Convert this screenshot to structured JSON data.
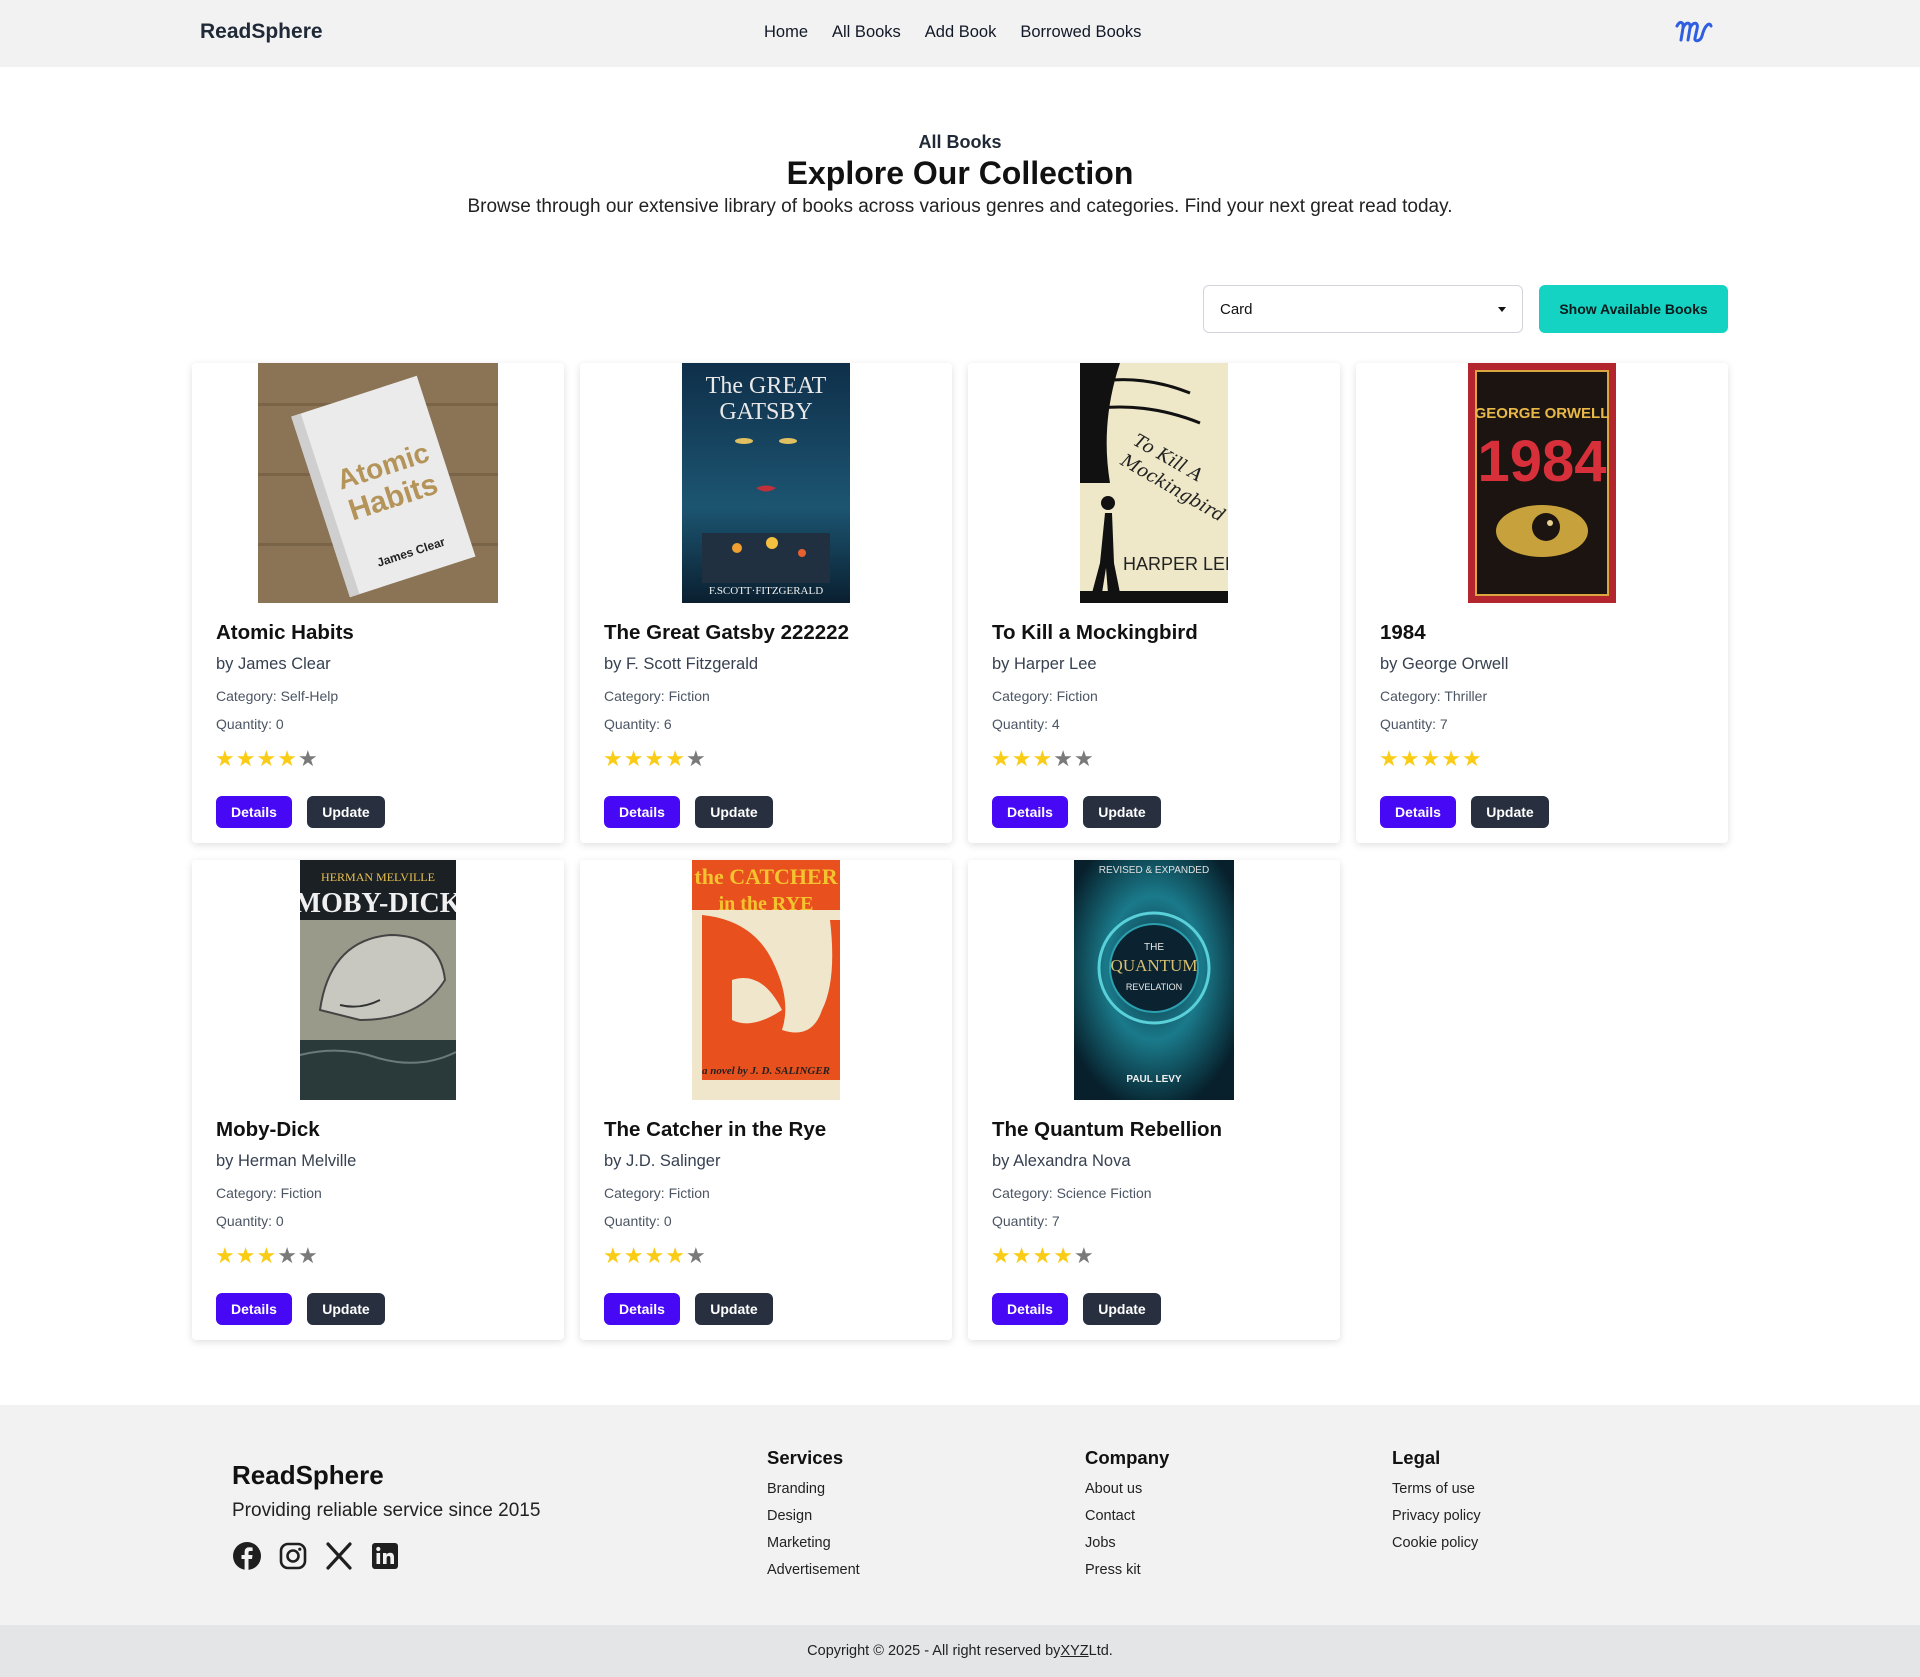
{
  "nav": {
    "brand": "ReadSphere",
    "links": [
      "Home",
      "All Books",
      "Add Book",
      "Borrowed Books"
    ]
  },
  "hero": {
    "kicker": "All Books",
    "title": "Explore Our Collection",
    "description": "Browse through our extensive library of books across various genres and categories. Find your next great read today."
  },
  "controls": {
    "view_value": "Card",
    "show_available_label": "Show Available Books"
  },
  "labels": {
    "details": "Details",
    "update": "Update"
  },
  "books": [
    {
      "title": "Atomic Habits",
      "author": "by James Clear",
      "category": "Category: Self-Help",
      "quantity": "Quantity: 0",
      "rating": 4,
      "cover_text": [
        "Atomic",
        "Habits",
        "James Clear"
      ]
    },
    {
      "title": "The Great Gatsby 222222",
      "author": "by F. Scott Fitzgerald",
      "category": "Category: Fiction",
      "quantity": "Quantity: 6",
      "rating": 4,
      "cover_text": [
        "The GREAT",
        "GATSBY",
        "F.SCOTT·FITZGERALD"
      ]
    },
    {
      "title": "To Kill a Mockingbird",
      "author": "by Harper Lee",
      "category": "Category: Fiction",
      "quantity": "Quantity: 4",
      "rating": 3,
      "cover_text": [
        "To Kill A",
        "Mockingbird",
        "HARPER LEE"
      ]
    },
    {
      "title": "1984",
      "author": "by George Orwell",
      "category": "Category: Thriller",
      "quantity": "Quantity: 7",
      "rating": 5,
      "cover_text": [
        "GEORGE ORWELL",
        "1984"
      ]
    },
    {
      "title": "Moby-Dick",
      "author": "by Herman Melville",
      "category": "Category: Fiction",
      "quantity": "Quantity: 0",
      "rating": 3,
      "cover_text": [
        "HERMAN MELVILLE",
        "MOBY-DICK"
      ]
    },
    {
      "title": "The Catcher in the Rye",
      "author": "by J.D. Salinger",
      "category": "Category: Fiction",
      "quantity": "Quantity: 0",
      "rating": 4,
      "cover_text": [
        "the CATCHER",
        "in the RYE",
        "a novel by J. D. SALINGER"
      ]
    },
    {
      "title": "The Quantum Rebellion",
      "author": "by Alexandra Nova",
      "category": "Category: Science Fiction",
      "quantity": "Quantity: 7",
      "rating": 4,
      "cover_text": [
        "REVISED & EXPANDED",
        "THE",
        "QUANTUM",
        "REVELATION",
        "PAUL LEVY"
      ]
    }
  ],
  "footer": {
    "brand": "ReadSphere",
    "tagline": "Providing reliable service since 2015",
    "social_icons": [
      "facebook-icon",
      "instagram-icon",
      "x-icon",
      "linkedin-icon"
    ],
    "columns": [
      {
        "heading": "Services",
        "links": [
          "Branding",
          "Design",
          "Marketing",
          "Advertisement"
        ]
      },
      {
        "heading": "Company",
        "links": [
          "About us",
          "Contact",
          "Jobs",
          "Press kit"
        ]
      },
      {
        "heading": "Legal",
        "links": [
          "Terms of use",
          "Privacy policy",
          "Cookie policy"
        ]
      }
    ],
    "copyright_prefix": "Copyright © 2025 - All right reserved by ",
    "copyright_company": "XYZ",
    "copyright_suffix": " Ltd."
  },
  "colors": {
    "details_button": "#4708f5",
    "update_button": "#283040",
    "show_button": "#14d3c3",
    "star_on": "#facc15",
    "star_off": "#7a7a7a"
  }
}
